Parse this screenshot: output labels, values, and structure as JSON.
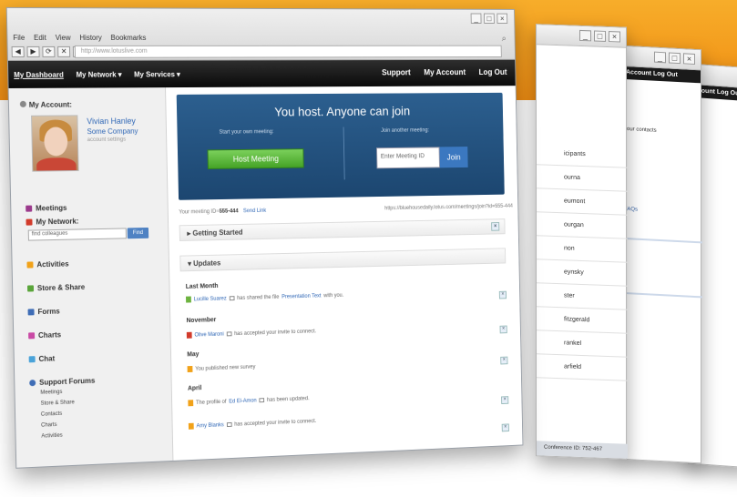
{
  "colors": {
    "brand_orange": "#f39a18",
    "accent_blue": "#2f67b6",
    "hero_blue": "#1c4670",
    "host_green": "#45a326"
  },
  "browser": {
    "menu": [
      "File",
      "Edit",
      "View",
      "History",
      "Bookmarks"
    ],
    "url": "http://www.lotuslive.com",
    "window_buttons": [
      "_",
      "□",
      "×"
    ]
  },
  "topnav": {
    "left": [
      "My Dashboard",
      "My Network ▾",
      "My Services ▾"
    ],
    "right": [
      "Support",
      "My Account",
      "Log Out"
    ]
  },
  "sidebar": {
    "account_title": "My Account:",
    "user_name": "Vivian Hanley",
    "company": "Some Company",
    "account_settings": "account settings",
    "meetings": "Meetings",
    "my_network": "My Network:",
    "search_placeholder": "find colleagues",
    "find_label": "Find",
    "activities": "Activities",
    "store_share": "Store & Share",
    "forms": "Forms",
    "charts": "Charts",
    "chat": "Chat",
    "support_forums": "Support Forums",
    "forum_items": [
      "Meetings",
      "Store & Share",
      "Contacts",
      "Charts",
      "Activities"
    ]
  },
  "hero": {
    "title": "You host. Anyone can join",
    "start_label": "Start your own meeting:",
    "join_label": "Join another meeting:",
    "host_button": "Host Meeting",
    "meeting_placeholder": "Enter Meeting ID",
    "join_button": "Join"
  },
  "meeting": {
    "id_label": "Your meeting ID=",
    "id_value": "555-444",
    "send_link": "Send Link",
    "url": "https://bluehousedaily.lotus.com/meetings/join?id=555-444"
  },
  "sections": {
    "getting_started": "Getting Started",
    "updates": "Updates"
  },
  "updates": [
    {
      "date": "Last Month",
      "actor": "Lucille Suarez",
      "text": "has shared the file",
      "object": "Presentation Text",
      "suffix": "with you."
    },
    {
      "date": "November",
      "actor": "Olive Maroni",
      "text": "has accepted your invite to connect.",
      "object": "",
      "suffix": ""
    },
    {
      "date": "May",
      "actor": "",
      "text": "You published new survey",
      "object": "",
      "suffix": ""
    },
    {
      "date": "April",
      "actor": "",
      "text": "The profile of",
      "object": "Ed El-Amon",
      "suffix": "has been updated."
    },
    {
      "date": "",
      "actor": "Amy Blanks",
      "text": "has accepted your invite to connect.",
      "object": "",
      "suffix": ""
    }
  ],
  "window2": {
    "list": [
      "icipants",
      "ourna",
      "eumont",
      "ourgan",
      "non",
      "eynsky",
      "ster",
      "fitzgerald",
      "rankel",
      "arfield"
    ],
    "footer": "Conference ID: 752-467"
  },
  "window3": {
    "nav": [
      "Account",
      "Log Out"
    ],
    "help": "Help",
    "contacts_title": "your contacts",
    "faq": "FAQs"
  },
  "window4": {
    "nav": [
      "ccount",
      "Log Ou"
    ]
  }
}
